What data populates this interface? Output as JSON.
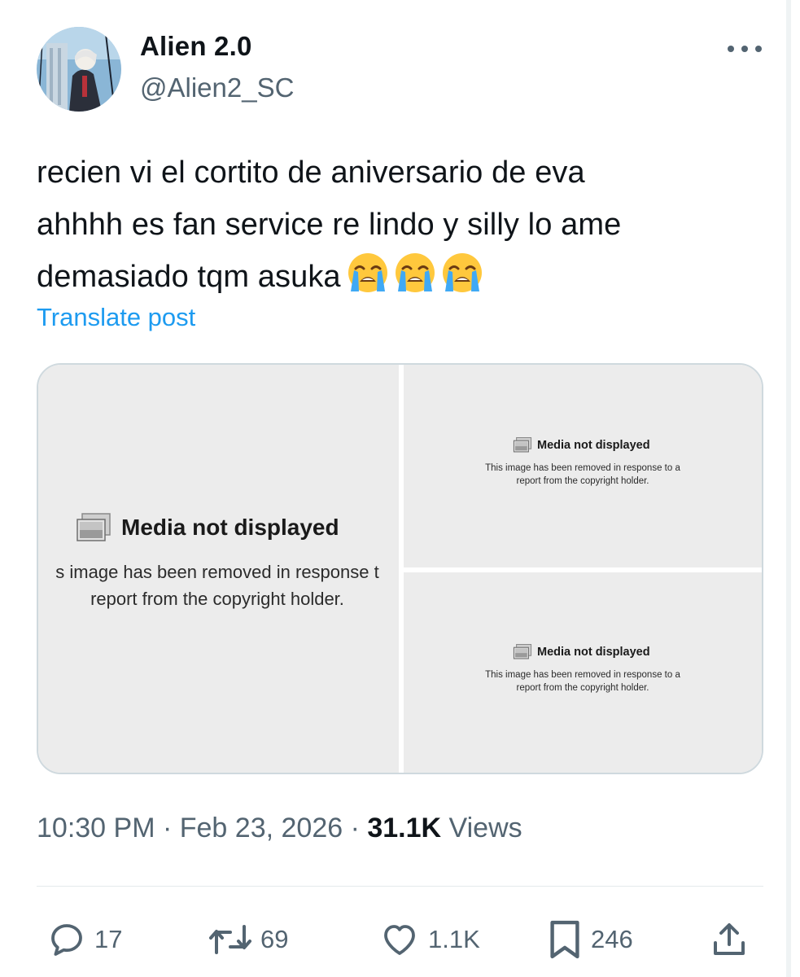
{
  "author": {
    "display_name": "Alien 2.0",
    "handle": "@Alien2_SC",
    "avatar_icon": "avatar"
  },
  "tweet": {
    "text": "recien vi el cortito de aniversario de eva\nahhhh es fan service re lindo y silly lo ame\ndemasiado tqm asuka",
    "emojis": [
      "loudly-crying-face",
      "loudly-crying-face",
      "loudly-crying-face"
    ],
    "translate_label": "Translate post"
  },
  "media": [
    {
      "title": "Media not displayed",
      "body": "s image has been removed in response t\nreport from the copyright holder."
    },
    {
      "title": "Media not displayed",
      "body": "This image has been removed in response to a\nreport from the copyright holder."
    },
    {
      "title": "Media not displayed",
      "body": "This image has been removed in response to a\nreport from the copyright holder."
    }
  ],
  "meta": {
    "time": "10:30 PM",
    "separator": " · ",
    "date": "Feb 23, 2026",
    "views_count": "31.1K",
    "views_label": "Views"
  },
  "actions": {
    "replies": "17",
    "reposts": "69",
    "likes": "1.1K",
    "bookmarks": "246"
  },
  "colors": {
    "link": "#1d9bf0",
    "secondary_text": "#536471",
    "primary_text": "#0f1419",
    "border": "#cfd9de",
    "media_placeholder_bg": "#ececec"
  }
}
